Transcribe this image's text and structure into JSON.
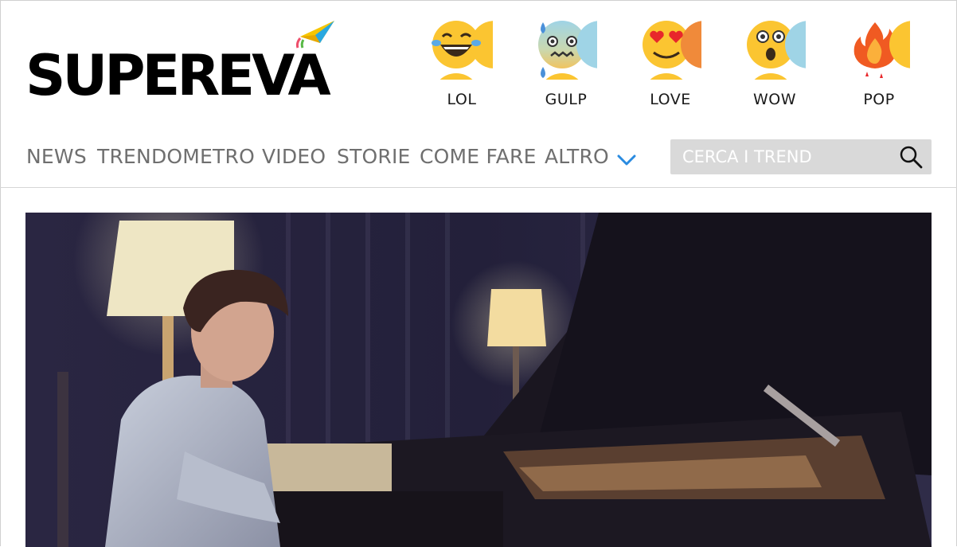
{
  "brand": {
    "name": "SUPEREVA"
  },
  "reactions": [
    {
      "label": "LOL",
      "icon": "laughing-face-icon"
    },
    {
      "label": "GULP",
      "icon": "anxious-sweat-face-icon"
    },
    {
      "label": "LOVE",
      "icon": "heart-eyes-face-icon"
    },
    {
      "label": "WOW",
      "icon": "surprised-face-icon"
    },
    {
      "label": "POP",
      "icon": "fire-icon"
    }
  ],
  "nav": {
    "items": [
      "NEWS",
      "TRENDOMETRO",
      "VIDEO",
      "STORIE",
      "COME FARE",
      "ALTRO"
    ]
  },
  "search": {
    "placeholder": "CERCA I TREND",
    "value": ""
  },
  "hero": {
    "image": "young-man-playing-grand-piano-photo"
  },
  "colors": {
    "nav_text": "#6f6f6f",
    "chevron": "#2a8be0",
    "search_bg": "#d9d9d9",
    "emoji_yellow": "#fbc531"
  }
}
